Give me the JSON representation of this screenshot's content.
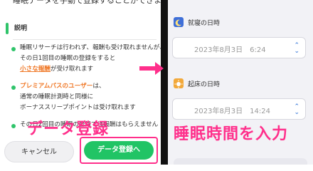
{
  "left": {
    "top_text": "睡眠データを手動で登録することができます",
    "section_title": "説明",
    "items": [
      {
        "line1": "睡眠リサーチは行われず、報酬も受け取れませんが、",
        "line2": "その日1回目の睡眠の登録をすると",
        "line3": "小さな報酬",
        "line3b": "が受け取れます"
      },
      {
        "line1": "プレミアムパスのユーザー",
        "line1b": "は、",
        "line2": "通常の睡眠計測時と同様に",
        "line3": "ボーナススリープポイントは受け取れます"
      },
      {
        "line1": "その日2回目の睡眠の登録では報酬はもらえません"
      }
    ],
    "overlay": "データ登録",
    "cancel_label": "キャンセル",
    "register_label": "データ登録へ"
  },
  "right": {
    "bed_label": "就寝の日時",
    "bed_value": "2023年8月3日　6:24",
    "wake_label": "起床の日時",
    "wake_value": "2023年8月3日　14:24",
    "overlay": "睡眠時間を入力",
    "icons": {
      "bed": "moon-icon",
      "wake": "sun-icon",
      "picker": "chevron-updown-icon"
    }
  },
  "colors": {
    "accent_green": "#21c465",
    "highlight_pink": "#ff2f8b",
    "orange": "#f07a2a",
    "blue": "#2a6fd6"
  }
}
